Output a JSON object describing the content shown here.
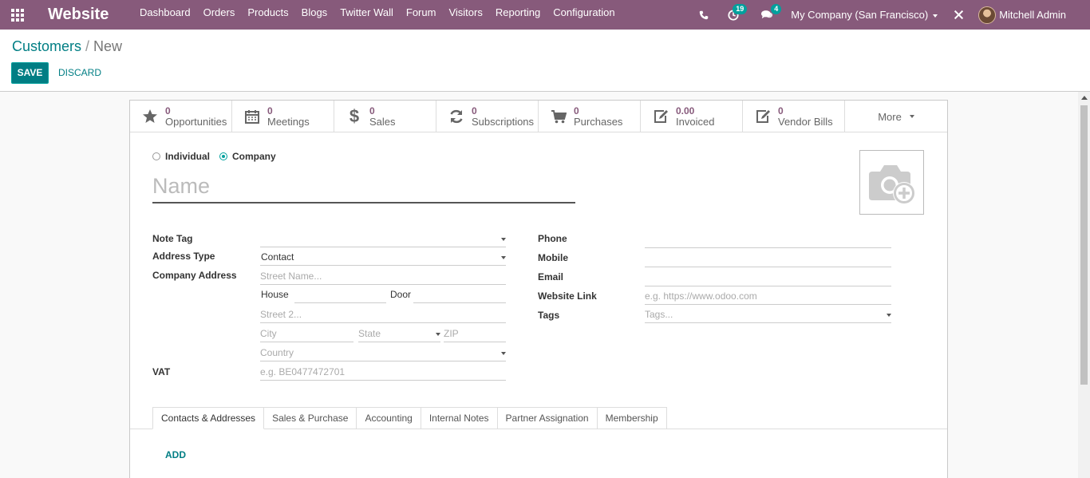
{
  "navbar": {
    "app_name": "Website",
    "menu": [
      "Dashboard",
      "Orders",
      "Products",
      "Blogs",
      "Twitter Wall",
      "Forum",
      "Visitors",
      "Reporting",
      "Configuration"
    ],
    "activity_count": "19",
    "message_count": "4",
    "company": "My Company (San Francisco)",
    "user": "Mitchell Admin"
  },
  "control": {
    "breadcrumb_parent": "Customers",
    "breadcrumb_current": "New",
    "save_label": "SAVE",
    "discard_label": "DISCARD"
  },
  "stats": [
    {
      "value": "0",
      "label": "Opportunities",
      "icon": "star-icon"
    },
    {
      "value": "0",
      "label": "Meetings",
      "icon": "calendar-icon"
    },
    {
      "value": "0",
      "label": "Sales",
      "icon": "dollar-icon"
    },
    {
      "value": "0",
      "label": "Subscriptions",
      "icon": "refresh-icon"
    },
    {
      "value": "0",
      "label": "Purchases",
      "icon": "cart-icon"
    },
    {
      "value": "0.00",
      "label": "Invoiced",
      "icon": "edit-icon"
    },
    {
      "value": "0",
      "label": "Vendor Bills",
      "icon": "edit-icon"
    }
  ],
  "more_label": "More",
  "form": {
    "individual_label": "Individual",
    "company_label": "Company",
    "name_placeholder": "Name",
    "note_tag_label": "Note Tag",
    "address_type_label": "Address Type",
    "address_type_value": "Contact",
    "company_address_label": "Company Address",
    "street_placeholder": "Street Name...",
    "house_label": "House",
    "door_label": "Door",
    "street2_placeholder": "Street 2...",
    "city_placeholder": "City",
    "state_placeholder": "State",
    "zip_placeholder": "ZIP",
    "country_placeholder": "Country",
    "vat_label": "VAT",
    "vat_placeholder": "e.g. BE0477472701",
    "phone_label": "Phone",
    "mobile_label": "Mobile",
    "email_label": "Email",
    "website_label": "Website Link",
    "website_placeholder": "e.g. https://www.odoo.com",
    "tags_label": "Tags",
    "tags_placeholder": "Tags..."
  },
  "tabs": [
    "Contacts & Addresses",
    "Sales & Purchase",
    "Accounting",
    "Internal Notes",
    "Partner Assignation",
    "Membership"
  ],
  "add_label": "ADD"
}
